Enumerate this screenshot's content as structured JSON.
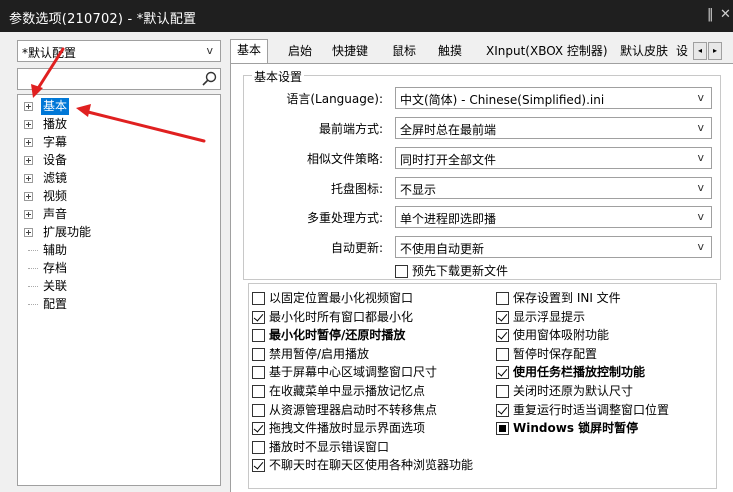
{
  "window": {
    "title": "参数选项(210702) - *默认配置",
    "pin_glyph": "‖",
    "close_glyph": "✕"
  },
  "sidebar": {
    "preset": {
      "value": "*默认配置",
      "arrow": "v"
    },
    "search": {
      "value": "",
      "placeholder": ""
    },
    "tree": [
      {
        "label": "基本",
        "expandable": true,
        "selected": true
      },
      {
        "label": "播放",
        "expandable": true
      },
      {
        "label": "字幕",
        "expandable": true
      },
      {
        "label": "设备",
        "expandable": true
      },
      {
        "label": "滤镜",
        "expandable": true
      },
      {
        "label": "视频",
        "expandable": true
      },
      {
        "label": "声音",
        "expandable": true
      },
      {
        "label": "扩展功能",
        "expandable": true
      },
      {
        "label": "辅助",
        "expandable": false
      },
      {
        "label": "存档",
        "expandable": false
      },
      {
        "label": "关联",
        "expandable": false
      },
      {
        "label": "配置",
        "expandable": false
      }
    ]
  },
  "tabs": {
    "items": [
      "基本",
      "启始",
      "快捷键",
      "鼠标",
      "触摸",
      "XInput(XBOX 控制器)",
      "默认皮肤",
      "设"
    ],
    "active": "基本",
    "scroll_left": "◂",
    "scroll_right": "▸"
  },
  "basic": {
    "group_title": "基本设置",
    "settings": [
      {
        "label": "语言(Language):",
        "value": "中文(简体) - Chinese(Simplified).ini"
      },
      {
        "label": "最前端方式:",
        "value": "全屏时总在最前端"
      },
      {
        "label": "相似文件策略:",
        "value": "同时打开全部文件"
      },
      {
        "label": "托盘图标:",
        "value": "不显示"
      },
      {
        "label": "多重处理方式:",
        "value": "单个进程即选即播"
      },
      {
        "label": "自动更新:",
        "value": "不使用自动更新"
      }
    ],
    "combo_arrow": "v",
    "predownload": {
      "label": "预先下载更新文件",
      "checked": false
    }
  },
  "options_left": [
    {
      "label": "以固定位置最小化视频窗口",
      "state": "unchecked",
      "bold": false
    },
    {
      "label": "最小化时所有窗口都最小化",
      "state": "checked",
      "bold": false
    },
    {
      "label": "最小化时暂停/还原时播放",
      "state": "unchecked",
      "bold": true
    },
    {
      "label": "禁用暂停/启用播放",
      "state": "unchecked",
      "bold": false
    },
    {
      "label": "基于屏幕中心区域调整窗口尺寸",
      "state": "unchecked",
      "bold": false
    },
    {
      "label": "在收藏菜单中显示播放记忆点",
      "state": "unchecked",
      "bold": false
    },
    {
      "label": "从资源管理器启动时不转移焦点",
      "state": "unchecked",
      "bold": false
    },
    {
      "label": "拖拽文件播放时显示界面选项",
      "state": "checked",
      "bold": false
    },
    {
      "label": "播放时不显示错误窗口",
      "state": "unchecked",
      "bold": false
    },
    {
      "label": "不聊天时在聊天区使用各种浏览器功能",
      "state": "checked",
      "bold": false
    }
  ],
  "options_right": [
    {
      "label": "保存设置到 INI 文件",
      "state": "unchecked",
      "bold": false
    },
    {
      "label": "显示浮显提示",
      "state": "checked",
      "bold": false
    },
    {
      "label": "使用窗体吸附功能",
      "state": "checked",
      "bold": false
    },
    {
      "label": "暂停时保存配置",
      "state": "unchecked",
      "bold": false
    },
    {
      "label": "使用任务栏播放控制功能",
      "state": "checked",
      "bold": true
    },
    {
      "label": "关闭时还原为默认尺寸",
      "state": "unchecked",
      "bold": false
    },
    {
      "label": "重复运行时适当调整窗口位置",
      "state": "checked",
      "bold": false
    },
    {
      "label": "Windows 锁屏时暂停",
      "state": "mixed",
      "bold": true
    }
  ],
  "colors": {
    "titlebar": "#1f1f1f",
    "selection": "#0078d7",
    "annotation_arrow": "#e02020"
  }
}
